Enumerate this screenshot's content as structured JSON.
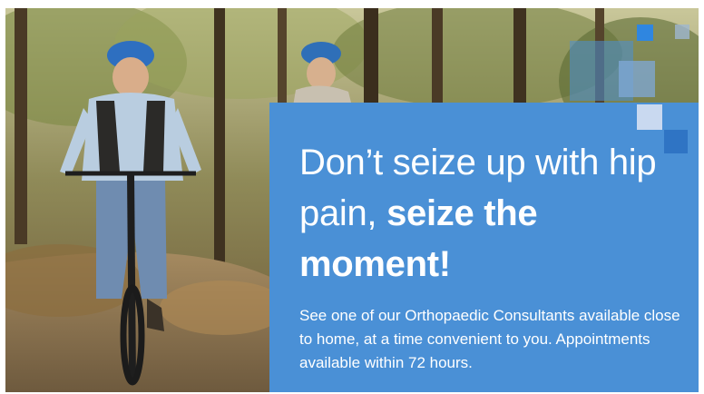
{
  "ad": {
    "headline_light": "Don’t seize up with hip pain, ",
    "headline_bold": "seize the moment!",
    "body": "See one of our Orthopaedic Consultants available close to home, at a time convenient to you. Appointments available within 72 hours."
  },
  "colors": {
    "panel_blue": "#4a90d6",
    "accent_light": "#c9d9f0",
    "accent_dark": "#2f74c4"
  },
  "photo": {
    "subject": "older man and woman cycling on a forest trail wearing blue helmets"
  }
}
